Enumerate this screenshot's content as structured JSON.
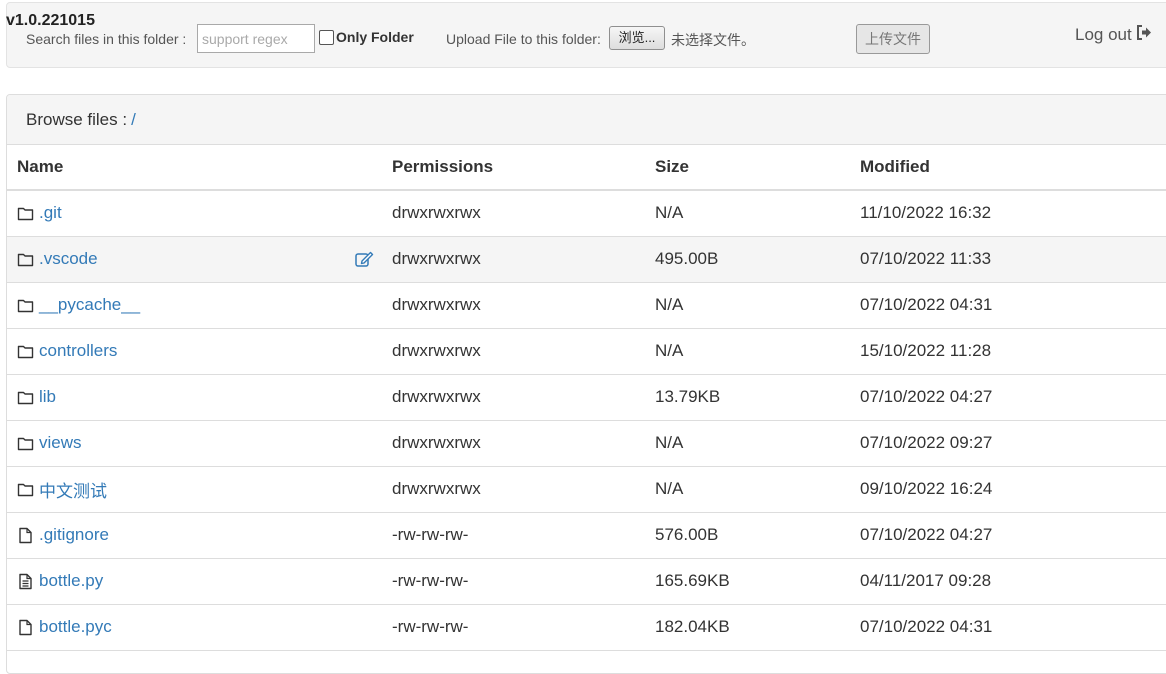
{
  "header": {
    "version": "v1.0.221015",
    "search_label": "Search files in this folder :",
    "search_placeholder": "support regex",
    "only_folder_label": "Only Folder",
    "upload_label": "Upload File to this folder:",
    "browse_button": "浏览...",
    "no_file_selected": "未选择文件。",
    "upload_button": "上传文件",
    "logout_label": "Log out",
    "logout_icon": "sign-out-icon"
  },
  "browse": {
    "label": "Browse files :",
    "path": "/"
  },
  "table": {
    "columns": [
      "Name",
      "Permissions",
      "Size",
      "Modified"
    ],
    "rows": [
      {
        "name": ".git",
        "type": "folder",
        "icon": "folder-icon",
        "permissions": "drwxrwxrwx",
        "size": "N/A",
        "modified": "11/10/2022 16:32"
      },
      {
        "name": ".vscode",
        "type": "folder",
        "icon": "folder-icon",
        "permissions": "drwxrwxrwx",
        "size": "495.00B",
        "modified": "07/10/2022 11:33"
      },
      {
        "name": "__pycache__",
        "type": "folder",
        "icon": "folder-icon",
        "permissions": "drwxrwxrwx",
        "size": "N/A",
        "modified": "07/10/2022 04:31"
      },
      {
        "name": "controllers",
        "type": "folder",
        "icon": "folder-icon",
        "permissions": "drwxrwxrwx",
        "size": "N/A",
        "modified": "15/10/2022 11:28"
      },
      {
        "name": "lib",
        "type": "folder",
        "icon": "folder-icon",
        "permissions": "drwxrwxrwx",
        "size": "13.79KB",
        "modified": "07/10/2022 04:27"
      },
      {
        "name": "views",
        "type": "folder",
        "icon": "folder-icon",
        "permissions": "drwxrwxrwx",
        "size": "N/A",
        "modified": "07/10/2022 09:27"
      },
      {
        "name": "中文测试",
        "type": "folder",
        "icon": "folder-icon",
        "permissions": "drwxrwxrwx",
        "size": "N/A",
        "modified": "09/10/2022 16:24"
      },
      {
        "name": ".gitignore",
        "type": "file",
        "icon": "file-icon",
        "permissions": "-rw-rw-rw-",
        "size": "576.00B",
        "modified": "07/10/2022 04:27"
      },
      {
        "name": "bottle.py",
        "type": "text",
        "icon": "file-text-icon",
        "permissions": "-rw-rw-rw-",
        "size": "165.69KB",
        "modified": "04/11/2017 09:28"
      },
      {
        "name": "bottle.pyc",
        "type": "file",
        "icon": "file-icon",
        "permissions": "-rw-rw-rw-",
        "size": "182.04KB",
        "modified": "07/10/2022 04:31"
      }
    ],
    "hovered_row": 1,
    "hover_action_icon": "edit-icon"
  },
  "colors": {
    "link": "#337ab7",
    "header_bg": "#f5f5f5",
    "border": "#dddddd",
    "text": "#333333"
  }
}
